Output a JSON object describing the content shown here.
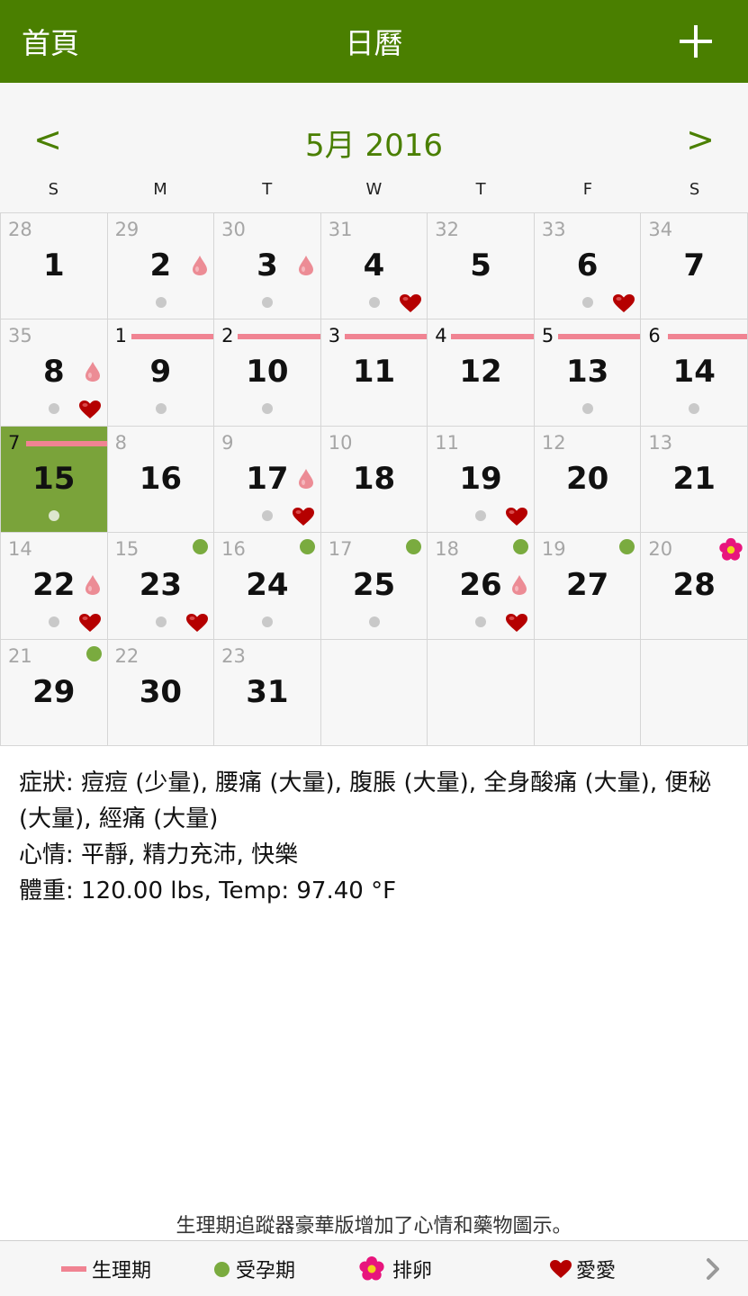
{
  "header": {
    "home_label": "首頁",
    "title": "日曆",
    "add_icon": "plus-icon"
  },
  "calendar": {
    "month_title": "5月 2016",
    "prev_label": "<",
    "next_label": ">",
    "weekdays": [
      "S",
      "M",
      "T",
      "W",
      "T",
      "F",
      "S"
    ],
    "colors": {
      "accent": "#4a7f00",
      "today": "#7aa33a",
      "period": "#f08392",
      "fertile": "#7aab3f",
      "heart": "#b50000"
    },
    "cells": [
      {
        "cycle": "28",
        "day": "1"
      },
      {
        "cycle": "29",
        "day": "2",
        "drop": true,
        "dot": true
      },
      {
        "cycle": "30",
        "day": "3",
        "drop": true,
        "dot": true
      },
      {
        "cycle": "31",
        "day": "4",
        "dot": true,
        "heart": true
      },
      {
        "cycle": "32",
        "day": "5"
      },
      {
        "cycle": "33",
        "day": "6",
        "dot": true,
        "heart": true
      },
      {
        "cycle": "34",
        "day": "7"
      },
      {
        "cycle": "35",
        "day": "8",
        "drop": true,
        "dot": true,
        "heart": true
      },
      {
        "cycle": "1",
        "day": "9",
        "period": true,
        "dot": true
      },
      {
        "cycle": "2",
        "day": "10",
        "period": true,
        "dot": true
      },
      {
        "cycle": "3",
        "day": "11",
        "period": true
      },
      {
        "cycle": "4",
        "day": "12",
        "period": true
      },
      {
        "cycle": "5",
        "day": "13",
        "period": true,
        "dot": true
      },
      {
        "cycle": "6",
        "day": "14",
        "period": true,
        "dot": true
      },
      {
        "cycle": "7",
        "day": "15",
        "period": true,
        "dot": true,
        "today": true
      },
      {
        "cycle": "8",
        "day": "16"
      },
      {
        "cycle": "9",
        "day": "17",
        "drop": true,
        "dot": true,
        "heart": true
      },
      {
        "cycle": "10",
        "day": "18"
      },
      {
        "cycle": "11",
        "day": "19",
        "dot": true,
        "heart": true
      },
      {
        "cycle": "12",
        "day": "20"
      },
      {
        "cycle": "13",
        "day": "21"
      },
      {
        "cycle": "14",
        "day": "22",
        "drop": true,
        "dot": true,
        "heart": true
      },
      {
        "cycle": "15",
        "day": "23",
        "fertile": true,
        "dot": true,
        "heart": true
      },
      {
        "cycle": "16",
        "day": "24",
        "fertile": true,
        "dot": true
      },
      {
        "cycle": "17",
        "day": "25",
        "fertile": true,
        "dot": true
      },
      {
        "cycle": "18",
        "day": "26",
        "fertile": true,
        "drop": true,
        "dot": true,
        "heart": true
      },
      {
        "cycle": "19",
        "day": "27",
        "fertile": true
      },
      {
        "cycle": "20",
        "day": "28",
        "ovulation": true
      },
      {
        "cycle": "21",
        "day": "29",
        "fertile": true
      },
      {
        "cycle": "22",
        "day": "30"
      },
      {
        "cycle": "23",
        "day": "31"
      },
      {
        "empty": true
      },
      {
        "empty": true
      },
      {
        "empty": true
      },
      {
        "empty": true
      }
    ]
  },
  "details": {
    "symptoms": "症狀:  痘痘 (少量), 腰痛 (大量), 腹脹 (大量), 全身酸痛 (大量), 便秘 (大量), 經痛 (大量)",
    "mood": "心情:  平靜, 精力充沛, 快樂",
    "weight": "體重: 120.00 lbs, Temp: 97.40 °F"
  },
  "promo": "生理期追蹤器豪華版增加了心情和藥物圖示。",
  "legend": {
    "period": "生理期",
    "fertile": "受孕期",
    "ovulation": "排卵",
    "intercourse": "愛愛",
    "more_icon": "chevron-right-icon"
  }
}
